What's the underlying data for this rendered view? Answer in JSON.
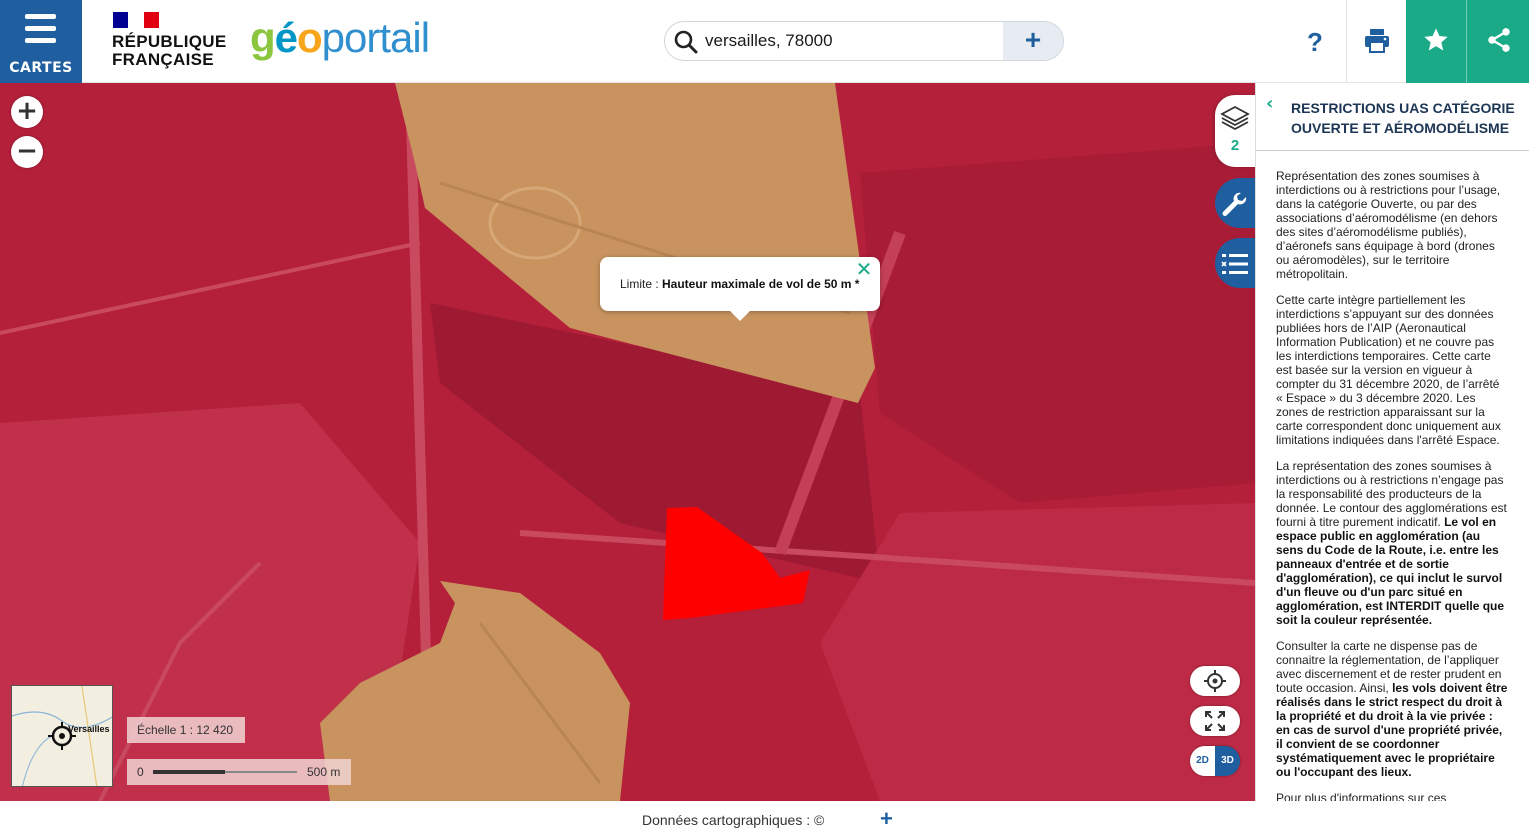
{
  "header": {
    "menu_label": "CARTES",
    "republique_line1": "RÉPUBLIQUE",
    "republique_line2": "FRANÇAISE",
    "logo_g": "g",
    "logo_e": "é",
    "logo_o": "o",
    "logo_rest": "portail",
    "search_value": "versailles, 78000",
    "help_label": "?",
    "colors": {
      "brand_blue": "#1f5fa0",
      "accent_green": "#1aaa88"
    }
  },
  "map": {
    "zoom_in": "+",
    "zoom_out": "−",
    "popup": {
      "prefix": "Limite : ",
      "value": "Hauteur maximale de vol de 50 m *",
      "close": "✕"
    },
    "overview_label": "Versailles",
    "scale_text": "Échelle 1 : 12 420",
    "scale_bar_start": "0",
    "scale_bar_end": "500 m",
    "toggle_2d": "2D",
    "toggle_3d": "3D",
    "layer_count": "2",
    "zone_colors": {
      "restricted": "#b41f3a",
      "limited_50m": "#c8935e",
      "prohibited": "#ff0000"
    }
  },
  "panel": {
    "back": "‹",
    "title": "RESTRICTIONS UAS CATÉGORIE OUVERTE ET AÉROMODÉLISME",
    "p1": "Représentation des zones soumises à interdictions ou à restrictions pour l’usage, dans la catégorie Ouverte, ou par des associations d’aéromodélisme (en dehors des sites d’aéromodélisme publiés), d’aéronefs sans équipage à bord (drones ou aéromodèles), sur le territoire métropolitain.",
    "p2": "Cette carte intègre partiellement les interdictions s’appuyant sur des données publiées hors de l’AIP (Aeronautical Information Publication) et ne couvre pas les interdictions temporaires. Cette carte est basée sur la version en vigueur à compter du 31 décembre 2020, de l’arrêté « Espace » du 3 décembre 2020. Les zones de restriction apparaissant sur la carte correspondent donc uniquement aux limitations indiquées dans l'arrêté Espace.",
    "p3_plain": "La représentation des zones soumises à interdictions ou à restrictions n’engage pas la responsabilité des producteurs de la donnée. Le contour des agglomérations est fourni à titre purement indicatif. ",
    "p3_bold": "Le vol en espace public en agglomération (au sens du Code de la Route, i.e. entre les panneaux d'entrée et de sortie d'agglomération), ce qui inclut le survol d'un fleuve ou d'un parc situé en agglomération, est INTERDIT quelle que soit la couleur représentée.",
    "p4_plain": "Consulter la carte ne dispense pas de connaitre la réglementation, de l’appliquer avec discernement et de rester prudent en toute occasion. Ainsi, ",
    "p4_bold": "les vols doivent être réalisés dans le strict respect du droit à la propriété et du droit à la vie privée : en cas de survol d'une propriété privée, il convient de se coordonner systématiquement avec le propriétaire ou l'occupant des lieux.",
    "p5": "Pour plus d'informations sur ces"
  },
  "footer": {
    "attribution": "Données cartographiques : ©",
    "more": "+"
  }
}
